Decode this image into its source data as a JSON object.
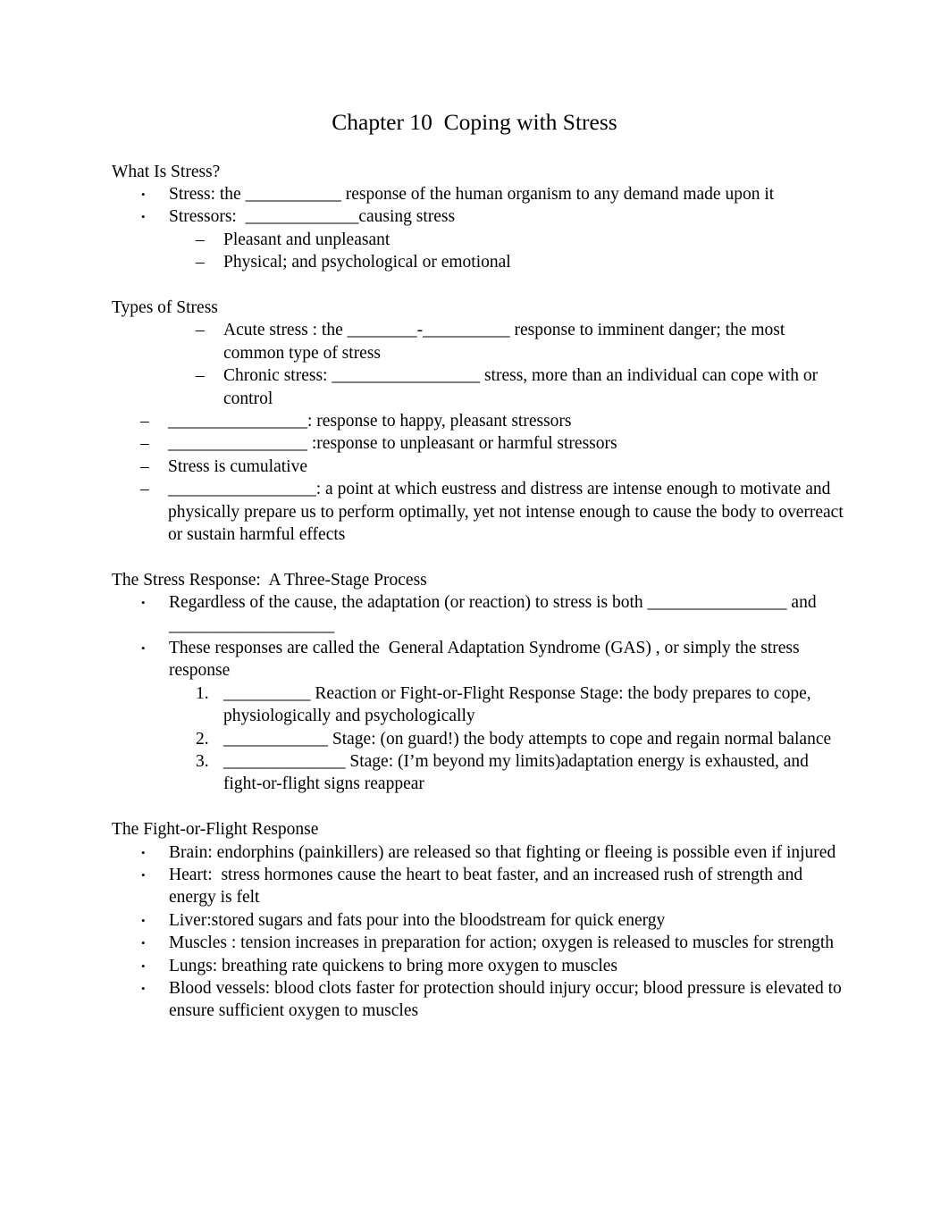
{
  "document": {
    "title": "Chapter 10  Coping with Stress",
    "sections": [
      {
        "heading": "What Is Stress?",
        "items": [
          {
            "level": 1,
            "marker": "•",
            "text": "Stress: the ___________ response of the human organism to any demand made upon it"
          },
          {
            "level": 1,
            "marker": "•",
            "text": "Stressors:  _____________causing stress"
          },
          {
            "level": 2,
            "marker": "–",
            "text": "Pleasant and unpleasant"
          },
          {
            "level": 2,
            "marker": "–",
            "text": "Physical; and psychological or emotional"
          }
        ]
      },
      {
        "heading": "Types of Stress",
        "items": [
          {
            "level": 2,
            "marker": "–",
            "text": "Acute stress : the ________-__________ response to imminent danger; the most common type of stress"
          },
          {
            "level": 2,
            "marker": "–",
            "text": "Chronic stress: _________________ stress, more than an individual can cope with or control"
          },
          {
            "level": 1,
            "marker": "–",
            "text": "________________: response to happy, pleasant stressors"
          },
          {
            "level": 1,
            "marker": "–",
            "text": "________________ :response to unpleasant or harmful stressors"
          },
          {
            "level": 1,
            "marker": "–",
            "text": "Stress is cumulative"
          },
          {
            "level": 1,
            "marker": "–",
            "text": "_________________: a point at which eustress and distress are intense enough to motivate and physically prepare us to perform optimally, yet not intense enough to cause the body to overreact or sustain harmful effects"
          }
        ]
      },
      {
        "heading": "The Stress Response:  A Three-Stage Process",
        "items": [
          {
            "level": 1,
            "marker": "•",
            "text": "Regardless of the cause, the adaptation (or reaction) to stress is both ________________ and ___________________"
          },
          {
            "level": 1,
            "marker": "•",
            "text": "These responses are called the  General Adaptation Syndrome (GAS) , or simply the stress response"
          },
          {
            "level": 2,
            "marker": "1.",
            "text": "__________ Reaction or Fight-or-Flight Response Stage: the body prepares to cope, physiologically and psychologically"
          },
          {
            "level": 2,
            "marker": "2.",
            "text": "____________ Stage: (on guard!) the body attempts to cope and regain normal balance"
          },
          {
            "level": 2,
            "marker": "3.",
            "text": "______________ Stage: (I’m beyond my limits)adaptation energy is exhausted, and fight-or-flight signs reappear"
          }
        ]
      },
      {
        "heading": "The Fight-or-Flight Response",
        "items": [
          {
            "level": 1,
            "marker": "•",
            "text": "Brain: endorphins (painkillers) are released so that fighting or fleeing is possible even if injured"
          },
          {
            "level": 1,
            "marker": "•",
            "text": "Heart:  stress hormones cause the heart to beat faster, and an increased rush of strength and energy is felt"
          },
          {
            "level": 1,
            "marker": "•",
            "text": "Liver:stored sugars and fats pour into the bloodstream for quick energy"
          },
          {
            "level": 1,
            "marker": "•",
            "text": "Muscles : tension increases in preparation for action; oxygen is released to muscles for strength"
          },
          {
            "level": 1,
            "marker": "•",
            "text": "Lungs: breathing rate quickens to bring more oxygen to muscles"
          },
          {
            "level": 1,
            "marker": "•",
            "text": "Blood vessels: blood clots faster for protection should injury occur; blood pressure is elevated to ensure sufficient oxygen to muscles"
          }
        ]
      }
    ]
  }
}
